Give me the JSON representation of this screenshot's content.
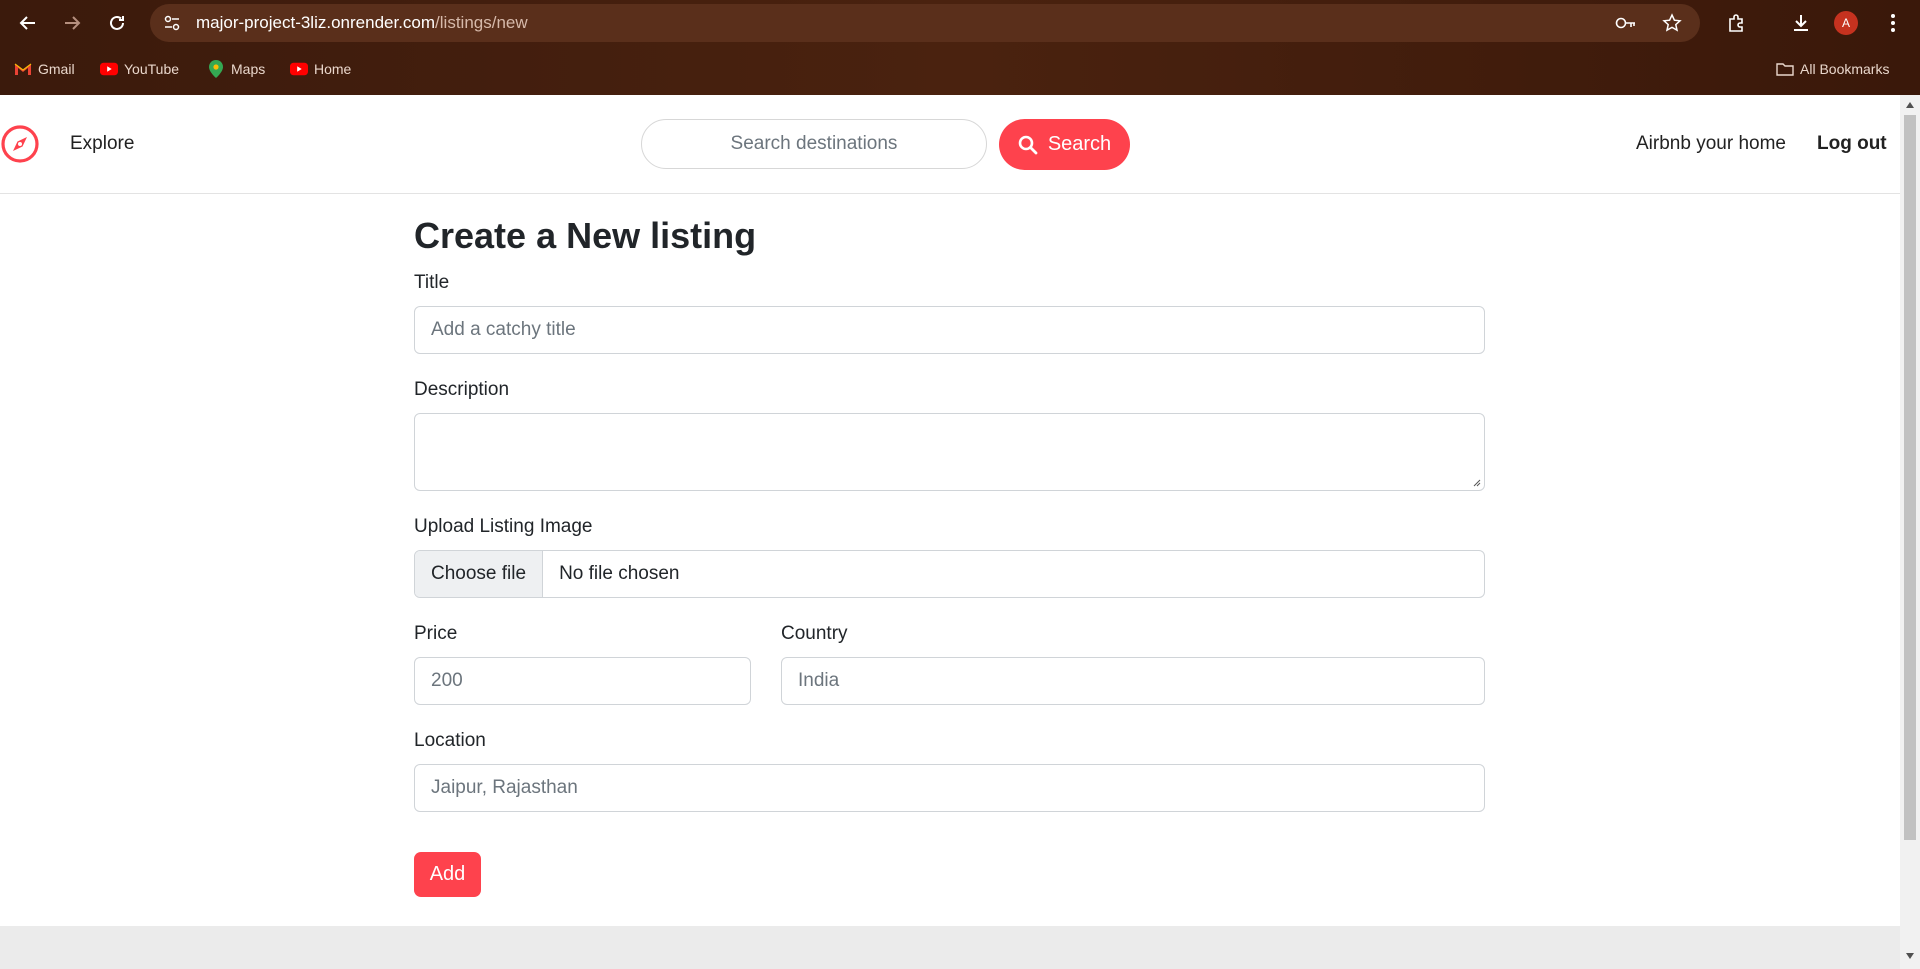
{
  "browser": {
    "url_host": "major-project-3liz.onrender.com",
    "url_path": "/listings/new",
    "profile_initial": "A",
    "bookmarks": [
      {
        "label": "Gmail",
        "icon": "gmail-icon"
      },
      {
        "label": "YouTube",
        "icon": "youtube-icon"
      },
      {
        "label": "Maps",
        "icon": "maps-icon"
      },
      {
        "label": "Home",
        "icon": "youtube-icon"
      }
    ],
    "all_bookmarks_label": "All Bookmarks"
  },
  "navbar": {
    "brand_icon": "compass-icon",
    "explore_label": "Explore",
    "search_placeholder": "Search destinations",
    "search_button_label": "Search",
    "host_label": "Airbnb your home",
    "logout_label": "Log out"
  },
  "form": {
    "heading": "Create a New listing",
    "title_label": "Title",
    "title_placeholder": "Add a catchy title",
    "description_label": "Description",
    "description_value": "",
    "image_label": "Upload Listing Image",
    "choose_file_label": "Choose file",
    "no_file_text": "No file chosen",
    "price_label": "Price",
    "price_placeholder": "200",
    "country_label": "Country",
    "country_placeholder": "India",
    "location_label": "Location",
    "location_placeholder": "Jaipur, Rajasthan",
    "submit_label": "Add"
  },
  "colors": {
    "accent": "#fe424d",
    "chrome_bg": "#3b1a0c"
  }
}
